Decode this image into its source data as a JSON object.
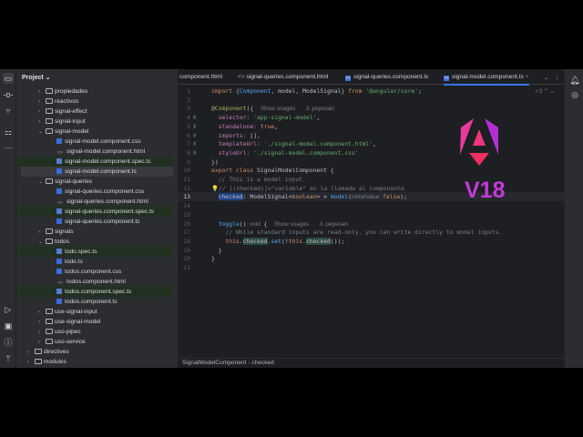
{
  "project": {
    "title": "Project",
    "items": [
      {
        "label": "propiedades",
        "type": "folder",
        "depth": 2,
        "open": false
      },
      {
        "label": "reactivos",
        "type": "folder",
        "depth": 2,
        "open": false
      },
      {
        "label": "signal-effect",
        "type": "folder",
        "depth": 2,
        "open": false
      },
      {
        "label": "signal-input",
        "type": "folder",
        "depth": 2,
        "open": false
      },
      {
        "label": "signal-model",
        "type": "folder",
        "depth": 2,
        "open": true
      },
      {
        "label": "signal-model.component.css",
        "type": "css",
        "depth": 3
      },
      {
        "label": "signal-model.component.html",
        "type": "html",
        "depth": 3
      },
      {
        "label": "signal-model.component.spec.ts",
        "type": "spec",
        "depth": 3
      },
      {
        "label": "signal-model.component.ts",
        "type": "ts",
        "depth": 3,
        "selected": true
      },
      {
        "label": "signal-queries",
        "type": "folder",
        "depth": 2,
        "open": true
      },
      {
        "label": "signal-queries.component.css",
        "type": "css",
        "depth": 3
      },
      {
        "label": "signal-queries.component.html",
        "type": "html",
        "depth": 3
      },
      {
        "label": "signal-queries.component.spec.ts",
        "type": "spec",
        "depth": 3
      },
      {
        "label": "signal-queries.component.ts",
        "type": "ts",
        "depth": 3
      },
      {
        "label": "signals",
        "type": "folder",
        "depth": 2,
        "open": false
      },
      {
        "label": "todos",
        "type": "folder",
        "depth": 2,
        "open": true
      },
      {
        "label": "todo.spec.ts",
        "type": "spec",
        "depth": 3
      },
      {
        "label": "todo.ts",
        "type": "ts",
        "depth": 3
      },
      {
        "label": "todos.component.css",
        "type": "css",
        "depth": 3
      },
      {
        "label": "todos.component.html",
        "type": "html",
        "depth": 3
      },
      {
        "label": "todos.component.spec.ts",
        "type": "spec",
        "depth": 3
      },
      {
        "label": "todos.component.ts",
        "type": "ts",
        "depth": 3
      },
      {
        "label": "use-signal-input",
        "type": "folder",
        "depth": 2,
        "open": false
      },
      {
        "label": "use-signal-model",
        "type": "folder",
        "depth": 2,
        "open": false
      },
      {
        "label": "uso-pipes",
        "type": "folder",
        "depth": 2,
        "open": false
      },
      {
        "label": "uso-service",
        "type": "folder",
        "depth": 2,
        "open": false
      },
      {
        "label": "directives",
        "type": "folder",
        "depth": 1,
        "open": false
      },
      {
        "label": "modules",
        "type": "folder",
        "depth": 1,
        "open": false
      }
    ]
  },
  "tabs": [
    {
      "label": "component.html"
    },
    {
      "label": "signal-queries.component.html",
      "icon": "<>"
    },
    {
      "label": "signal-queries.component.ts",
      "icon": "TS"
    },
    {
      "label": "signal-model.component.ts",
      "icon": "TS",
      "active": true
    }
  ],
  "inspection": "2",
  "code": [
    {
      "n": "1",
      "tok": [
        [
          "import ",
          "kw"
        ],
        [
          "{",
          "ty"
        ],
        [
          "Component",
          "id"
        ],
        [
          ", model, ModelSignal} ",
          "ty"
        ],
        [
          "from ",
          "kw"
        ],
        [
          "'@angular/core'",
          "str"
        ],
        [
          ";",
          "ty"
        ]
      ]
    },
    {
      "n": "2",
      "tok": []
    },
    {
      "n": "3",
      "tok": [
        [
          "@Component",
          "ann"
        ],
        [
          "({  ",
          "ty"
        ],
        [
          "Show usages      ♙ pepesan",
          "hint"
        ]
      ]
    },
    {
      "n": "4",
      "g": "@",
      "tok": [
        [
          "  selector: ",
          "fld"
        ],
        [
          "'app-signal-model'",
          "str"
        ],
        [
          ",",
          "ty"
        ]
      ]
    },
    {
      "n": "5",
      "g": "@",
      "tok": [
        [
          "  standalone: ",
          "fld"
        ],
        [
          "true",
          "kw"
        ],
        [
          ",",
          "ty"
        ]
      ]
    },
    {
      "n": "6",
      "g": "@",
      "tok": [
        [
          "  imports: ",
          "fld"
        ],
        [
          "[],",
          "ty"
        ]
      ]
    },
    {
      "n": "7",
      "g": "@",
      "tok": [
        [
          "  templateUrl: ",
          "fld"
        ],
        [
          "'./signal-model.component.html'",
          "str"
        ],
        [
          ",",
          "ty"
        ]
      ]
    },
    {
      "n": "8",
      "g": "@",
      "tok": [
        [
          "  styleUrl: ",
          "fld"
        ],
        [
          "'./signal-model.component.css'",
          "str"
        ]
      ]
    },
    {
      "n": "9",
      "tok": [
        [
          "})",
          "ty"
        ]
      ]
    },
    {
      "n": "10",
      "tok": [
        [
          "export class ",
          "kw"
        ],
        [
          "SignalModelComponent {",
          "ty"
        ]
      ]
    },
    {
      "n": "11",
      "tok": [
        [
          "  // This is a model input.",
          "cm"
        ]
      ]
    },
    {
      "n": "12",
      "tok": [
        [
          "💡// [(checked)]=\"variable\" en la llamada al componente",
          "cm"
        ]
      ]
    },
    {
      "n": "13",
      "cur": true,
      "tok": [
        [
          "  ",
          "ty"
        ],
        [
          "checked",
          "hl"
        ],
        [
          ": ModelSignal<",
          "ty"
        ],
        [
          "boolean",
          "kw"
        ],
        [
          "> = ",
          "ty"
        ],
        [
          "model",
          "fn"
        ],
        [
          "(",
          "ty"
        ],
        [
          "initialValue: ",
          "hint"
        ],
        [
          "false",
          "kw"
        ],
        [
          ");",
          "ty"
        ]
      ]
    },
    {
      "n": "14",
      "tok": []
    },
    {
      "n": "15",
      "tok": []
    },
    {
      "n": "16",
      "tok": [
        [
          "  ",
          "ty"
        ],
        [
          "toggle",
          "fn"
        ],
        [
          "()",
          "ty"
        ],
        [
          ": void  ",
          "hint"
        ],
        [
          "{  ",
          "ty"
        ],
        [
          "Show usages      ♙ pepesan",
          "hint"
        ]
      ]
    },
    {
      "n": "17",
      "tok": [
        [
          "    // While standard inputs are read-only, you can write directly to model inputs.",
          "cm"
        ]
      ]
    },
    {
      "n": "18",
      "tok": [
        [
          "    ",
          "ty"
        ],
        [
          "this",
          "kw"
        ],
        [
          ".",
          "ty"
        ],
        [
          "checked",
          "hl2"
        ],
        [
          ".",
          "ty"
        ],
        [
          "set",
          "fn"
        ],
        [
          "(!",
          "ty"
        ],
        [
          "this",
          "kw"
        ],
        [
          ".",
          "ty"
        ],
        [
          "checked",
          "hl2"
        ],
        [
          "());",
          "ty"
        ]
      ]
    },
    {
      "n": "19",
      "tok": [
        [
          "  }",
          "ty"
        ]
      ]
    },
    {
      "n": "20",
      "tok": [
        [
          "}",
          "ty"
        ]
      ]
    },
    {
      "n": "21",
      "tok": []
    }
  ],
  "overlay": {
    "version": "V18",
    "logo": "Angular"
  },
  "breadcrumb": [
    "SignalModelComponent",
    "checked"
  ],
  "colors": {
    "accent": "#3574f0",
    "logo": "#e0316e",
    "version": "#c23ad6"
  }
}
